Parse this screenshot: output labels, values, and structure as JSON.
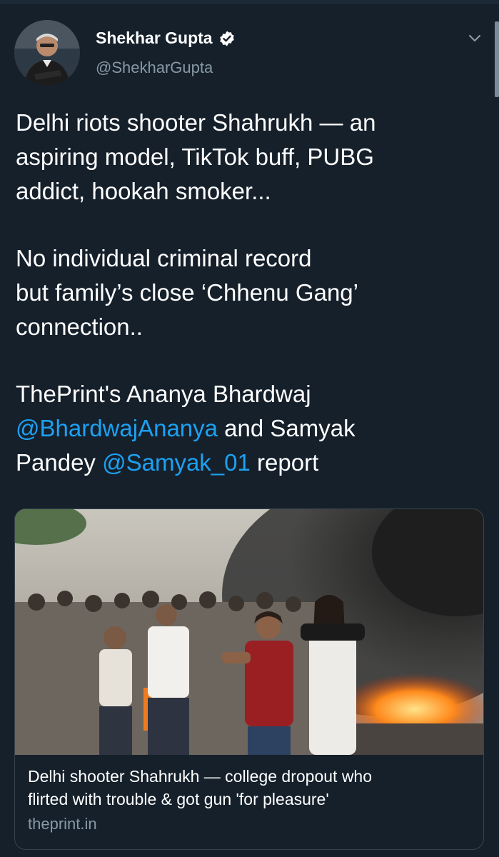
{
  "author": {
    "name": "Shekhar Gupta",
    "handle": "@ShekharGupta",
    "verified": true
  },
  "icons": {
    "verified": "verified-badge-icon",
    "menu": "chevron-down-icon"
  },
  "tweet": {
    "para1": [
      "Delhi riots shooter Shahrukh — an",
      "aspiring model, TikTok buff, PUBG",
      "addict, hookah smoker..."
    ],
    "para2": [
      "No individual criminal record",
      "but family’s close ‘Chhenu Gang’",
      "connection.."
    ],
    "para3_line1": "ThePrint's Ananya Bhardwaj",
    "mention1": "@BhardwajAnanya",
    "para3_mid": " and Samyak",
    "para3_line3_pre": "Pandey ",
    "mention2": "@Samyak_01",
    "para3_line3_post": " report"
  },
  "card": {
    "title_line1": "Delhi shooter Shahrukh — college dropout who",
    "title_line2": "flirted with trouble & got gun 'for pleasure'",
    "domain": "theprint.in"
  },
  "colors": {
    "background": "#15202b",
    "text": "#ffffff",
    "secondary": "#8899a6",
    "link": "#1da1f2",
    "border": "#38444d"
  }
}
